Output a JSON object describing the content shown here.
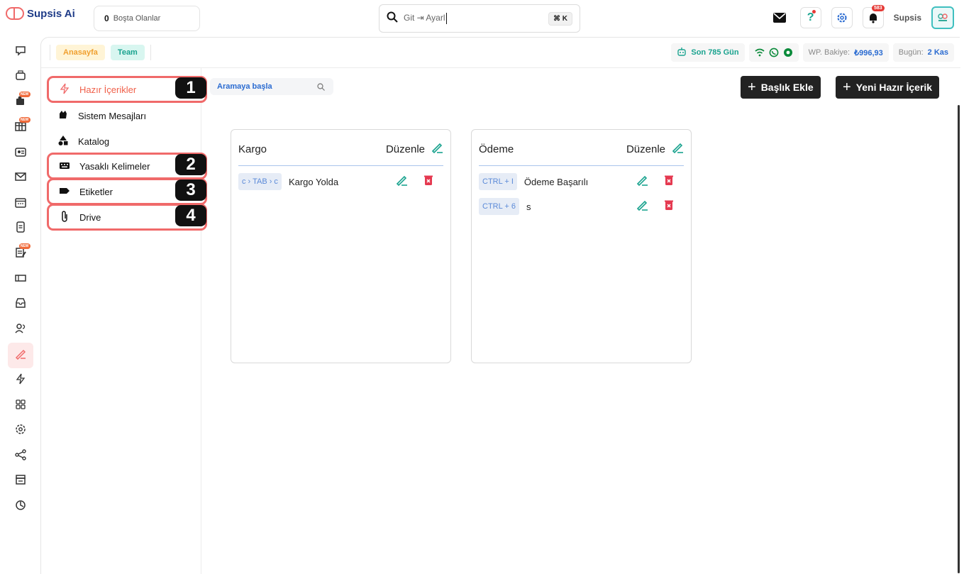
{
  "brand": {
    "name": "Supsis Ai"
  },
  "idle": {
    "count": "0",
    "label": "Boşta Olanlar"
  },
  "search": {
    "query": "Git ⇥ Ayarl",
    "shortcut": "⌘ K"
  },
  "user": {
    "name": "Supsis",
    "notification_count": "583"
  },
  "rail": {
    "items": [
      "chat-icon",
      "bot-icon",
      "puzzle-icon",
      "table-icon",
      "contact-card-icon",
      "mail-icon",
      "calendar-icon",
      "notes-icon",
      "tasks-icon",
      "ticket-icon",
      "inbox-icon",
      "users-icon",
      "ready-content-icon",
      "lightning-icon",
      "apps-icon",
      "settings-icon",
      "share-icon",
      "store-icon",
      "report-icon"
    ],
    "new_label": "NEW"
  },
  "breadcrumb": {
    "home": "Anasayfa",
    "team": "Team"
  },
  "status": {
    "days": "Son 785 Gün",
    "wp_label": "WP. Bakiye:",
    "wp_value": "₺996,93",
    "today_label": "Bugün:",
    "today_value": "2 Kas"
  },
  "subnav": {
    "items": [
      {
        "label": "Hazır İçerikler",
        "icon": "lightning-icon",
        "badge": "1"
      },
      {
        "label": "Sistem Mesajları",
        "icon": "wave-hand-icon",
        "badge": ""
      },
      {
        "label": "Katalog",
        "icon": "shapes-icon",
        "badge": ""
      },
      {
        "label": "Yasaklı Kelimeler",
        "icon": "keyboard-icon",
        "badge": "2"
      },
      {
        "label": "Etiketler",
        "icon": "tag-icon",
        "badge": "3"
      },
      {
        "label": "Drive",
        "icon": "paperclip-icon",
        "badge": "4"
      }
    ]
  },
  "content": {
    "search_placeholder": "Aramaya başla",
    "add_title_label": "Başlık Ekle",
    "new_content_label": "Yeni Hazır İçerik",
    "edit_label": "Düzenle"
  },
  "cards": [
    {
      "title": "Kargo",
      "rows": [
        {
          "shortcut": "c › TAB › c",
          "text": "Kargo Yolda"
        }
      ]
    },
    {
      "title": "Ödeme",
      "rows": [
        {
          "shortcut": "CTRL + I",
          "text": "Ödeme Başarılı"
        },
        {
          "shortcut": "CTRL + 6",
          "text": "s"
        }
      ]
    }
  ],
  "colors": {
    "accent": "#f06a6a",
    "teal": "#1aa38f",
    "blue": "#2a6bd1",
    "danger": "#e53950"
  }
}
